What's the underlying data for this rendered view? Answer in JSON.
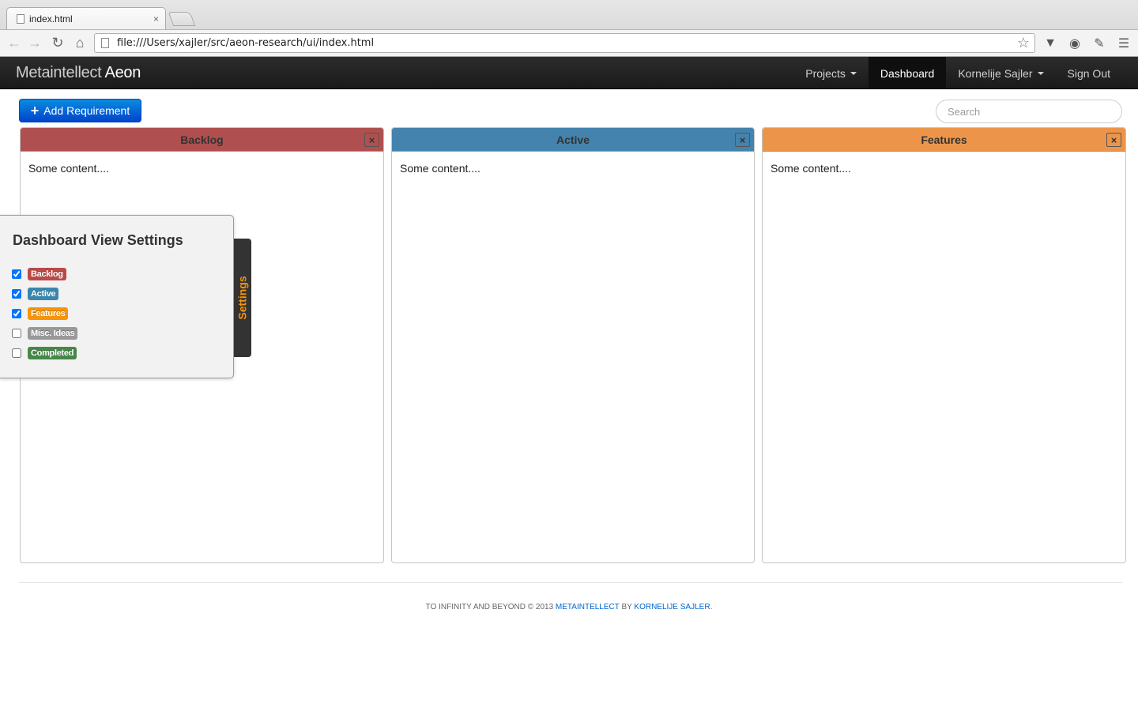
{
  "browser": {
    "tab_title": "index.html",
    "tab_close": "×",
    "url": "file:///Users/xajler/src/aeon-research/ui/index.html"
  },
  "navbar": {
    "brand_light": "Metaintellect ",
    "brand_strong": "Aeon",
    "items": [
      {
        "label": "Projects",
        "dropdown": true
      },
      {
        "label": "Dashboard",
        "active": true
      },
      {
        "label": "Kornelije Sajler",
        "dropdown": true
      },
      {
        "label": "Sign Out"
      }
    ]
  },
  "actions": {
    "add_label": "Add Requirement",
    "add_icon": "plus-icon",
    "search_placeholder": "Search"
  },
  "panels": [
    {
      "title": "Backlog",
      "content": "Some content....",
      "color": "#b04f4f",
      "close": "×"
    },
    {
      "title": "Active",
      "content": "Some content....",
      "color": "#4483ad",
      "close": "×"
    },
    {
      "title": "Features",
      "content": "Some content....",
      "color": "#ec954a",
      "close": "×"
    }
  ],
  "settings": {
    "title": "Dashboard View Settings",
    "tab_label": "Settings",
    "options": [
      {
        "label": "Backlog",
        "checked": true,
        "color": "#b94a48"
      },
      {
        "label": "Active",
        "checked": true,
        "color": "#3a87ad"
      },
      {
        "label": "Features",
        "checked": true,
        "color": "#f89406"
      },
      {
        "label": "Misc. Ideas",
        "checked": false,
        "color": "#999999"
      },
      {
        "label": "Completed",
        "checked": false,
        "color": "#468847"
      }
    ]
  },
  "footer": {
    "text1": "To infinity and beyond © 2013 ",
    "link1": "Metaintellect",
    "text2": " by ",
    "link2": "Kornelije Sajler",
    "text3": "."
  }
}
